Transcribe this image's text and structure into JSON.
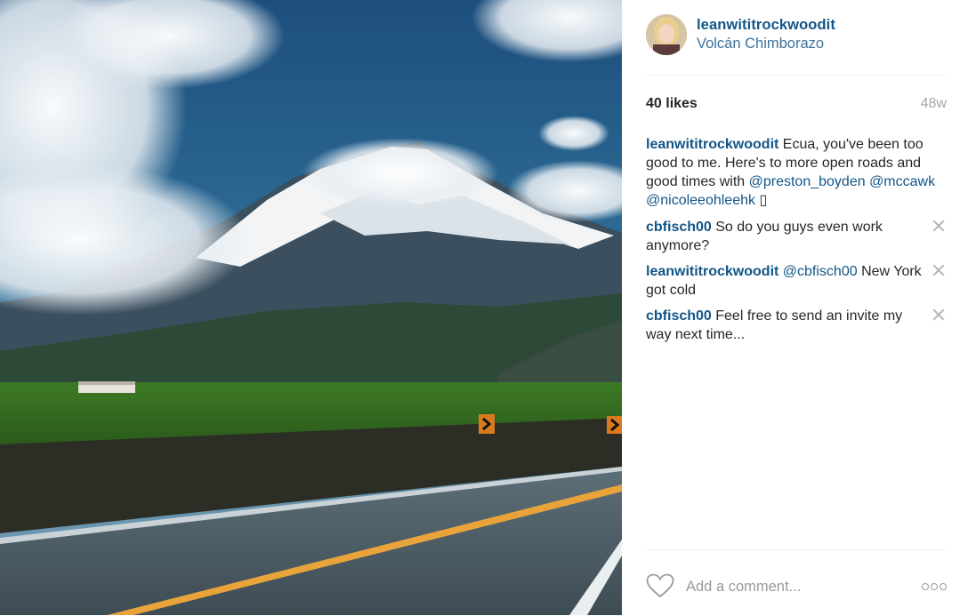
{
  "post": {
    "owner": "leanwititrockwoodit",
    "location": "Volcán Chimborazo",
    "likes": "40 likes",
    "age": "48w"
  },
  "caption": {
    "user": "leanwititrockwoodit",
    "text_1": " Ecua, you've been too good to me. Here's to more open roads and good times with ",
    "mention_1": "@preston_boyden",
    "sep_1": " ",
    "mention_2": "@mccawk",
    "sep_2": " ",
    "mention_3": "@nicoleeohleehk",
    "text_2": " ▯"
  },
  "comments": [
    {
      "user": "cbfisch00",
      "mention": "",
      "text": " So do you guys even work anymore?"
    },
    {
      "user": "leanwititrockwoodit",
      "mention": " @cbfisch00",
      "text": " New York got cold"
    },
    {
      "user": "cbfisch00",
      "mention": "",
      "text": " Feel free to send an invite my way next time..."
    }
  ],
  "footer": {
    "comment_placeholder": "Add a comment..."
  },
  "icons": {
    "like": "heart-icon",
    "delete": "close-icon",
    "more": "more-options-icon"
  },
  "colors": {
    "username": "#125688",
    "location": "#3f729b",
    "muted": "#a5a7aa",
    "divider": "#efefef"
  }
}
